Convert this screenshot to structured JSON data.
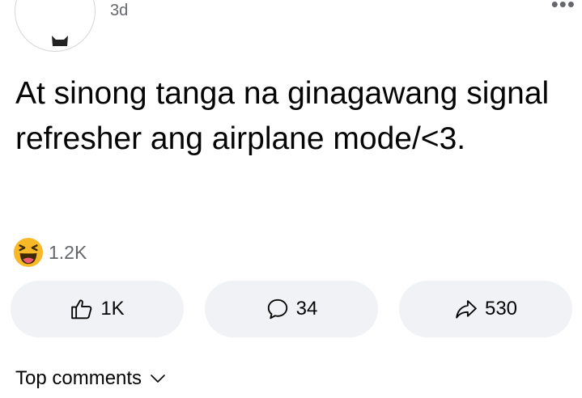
{
  "post": {
    "timestamp": "3d",
    "text": "At sinong tanga na ginagawang signal refresher ang airplane mode/<3.",
    "reaction_icon": "haha-emoji",
    "reaction_count": "1.2K"
  },
  "actions": {
    "like_count": "1K",
    "comment_count": "34",
    "share_count": "530"
  },
  "comments": {
    "sort_label": "Top comments"
  },
  "icons": {
    "more": "more-options-icon",
    "like": "thumbs-up-icon",
    "comment": "comment-bubble-icon",
    "share": "share-arrow-icon",
    "sort": "chevron-down-icon"
  },
  "colors": {
    "text": "#050505",
    "secondary_text": "#65676b",
    "button_bg": "#f0f2f5",
    "haha_yellow": "#f7b928"
  }
}
